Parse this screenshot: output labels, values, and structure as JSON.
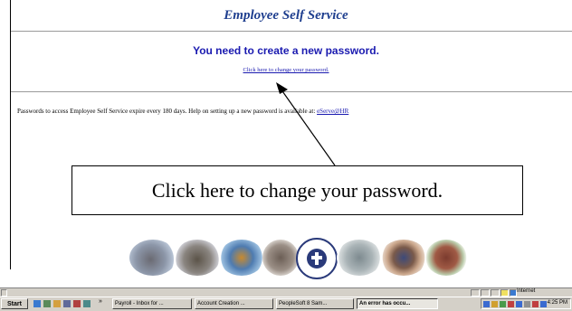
{
  "page": {
    "title": "Employee Self Service",
    "headline": "You need to create a new password.",
    "change_link": "Click here to change your password.",
    "info_text": "Passwords to access Employee Self Service expire every 180 days. Help on setting up a new password is available at:",
    "info_link": "eServe@HR"
  },
  "callout": {
    "text": "Click here to change your password."
  },
  "statusbar": {
    "zone": "Internet"
  },
  "taskbar": {
    "start_label": "Start",
    "more_label": "»",
    "buttons": [
      {
        "label": "Payroll - Inbox for ..."
      },
      {
        "label": "Account Creation ..."
      },
      {
        "label": "PeopleSoft 8 Sam..."
      },
      {
        "label": "An error has occu..."
      }
    ],
    "clock": "4:25 PM"
  },
  "colors": {
    "title": "#1f3f8f",
    "link": "#1a1ab0",
    "taskbar": "#d4d0c8"
  }
}
